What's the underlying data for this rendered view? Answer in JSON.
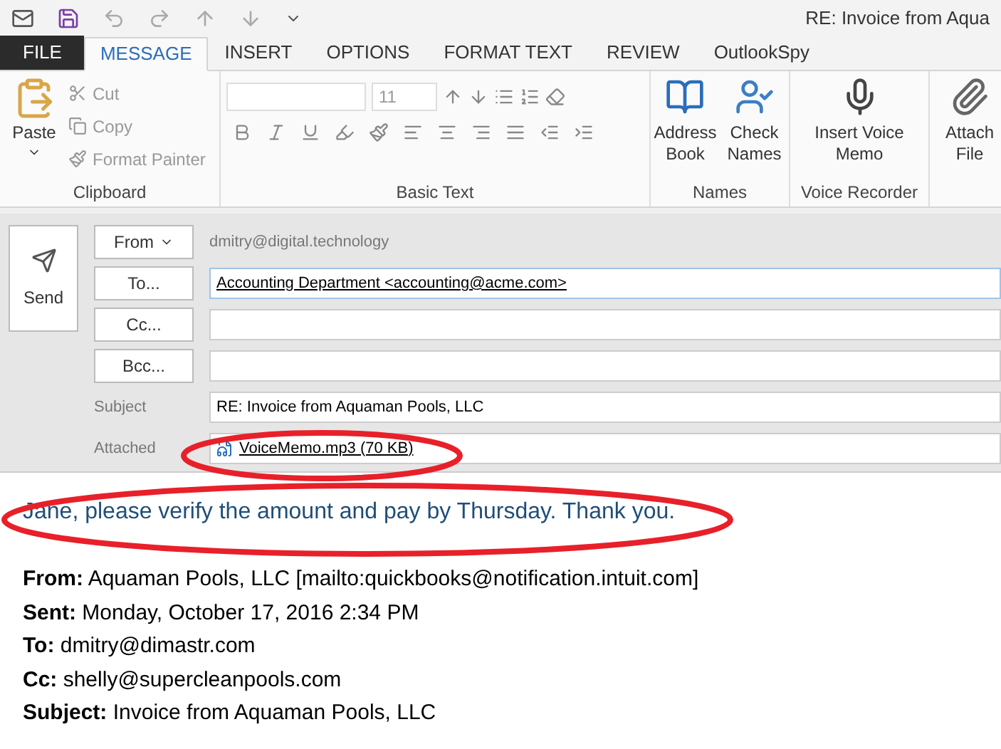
{
  "window": {
    "title": "RE: Invoice from Aqua"
  },
  "tabs": [
    {
      "label": "FILE",
      "kind": "file",
      "selected": false
    },
    {
      "label": "MESSAGE",
      "kind": "tab",
      "selected": true
    },
    {
      "label": "INSERT",
      "kind": "tab",
      "selected": false
    },
    {
      "label": "OPTIONS",
      "kind": "tab",
      "selected": false
    },
    {
      "label": "FORMAT TEXT",
      "kind": "tab",
      "selected": false
    },
    {
      "label": "REVIEW",
      "kind": "tab",
      "selected": false
    },
    {
      "label": "OutlookSpy",
      "kind": "tab",
      "selected": false
    }
  ],
  "ribbon": {
    "clipboard": {
      "label": "Clipboard",
      "paste": "Paste",
      "items": [
        {
          "label": "Cut",
          "disabled": true
        },
        {
          "label": "Copy",
          "disabled": true
        },
        {
          "label": "Format Painter",
          "disabled": true
        }
      ]
    },
    "basic_text": {
      "label": "Basic Text",
      "font_size": "11"
    },
    "names": {
      "label": "Names",
      "buttons": [
        {
          "label": "Address Book"
        },
        {
          "label": "Check Names"
        }
      ]
    },
    "voice_recorder": {
      "label": "Voice Recorder",
      "button": "Insert Voice Memo"
    },
    "attach": {
      "button": "Attach File"
    }
  },
  "compose": {
    "send": "Send",
    "fields": [
      {
        "kind": "from",
        "button": "From",
        "value": "dmitry@digital.technology"
      },
      {
        "kind": "recipient",
        "button": "To...",
        "value": "Accounting Department <accounting@acme.com>"
      },
      {
        "kind": "recipient",
        "button": "Cc..."
      },
      {
        "kind": "recipient",
        "button": "Bcc..."
      },
      {
        "kind": "subject",
        "label": "Subject",
        "value": "RE: Invoice from Aquaman Pools, LLC"
      },
      {
        "kind": "attached",
        "label": "Attached",
        "value": "VoiceMemo.mp3 (70 KB)"
      }
    ]
  },
  "body": {
    "message": "Jane, please verify the amount and pay by Thursday. Thank you.",
    "quoted": [
      "**From:** Aquaman Pools, LLC [mailto:quickbooks@notification.intuit.com]",
      "**Sent:** Monday, October 17, 2016 2:34 PM",
      "**To:** dmitry@dimastr.com",
      "**Cc:** shelly@supercleanpools.com",
      "**Subject:** Invoice from Aquaman Pools, LLC"
    ]
  }
}
